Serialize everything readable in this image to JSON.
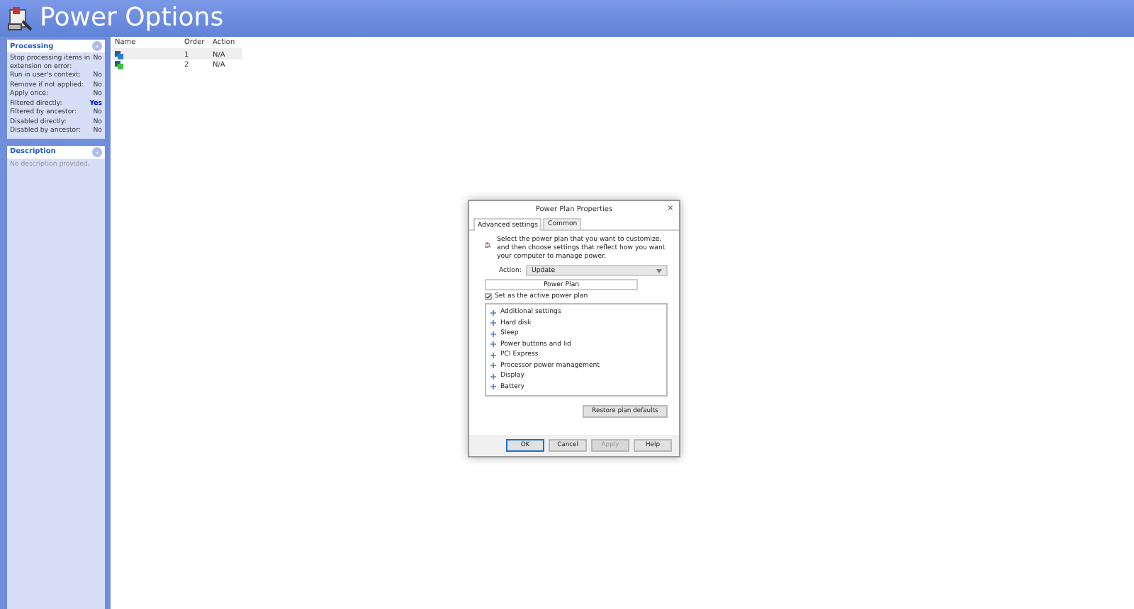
{
  "window": {
    "title": "Power Options"
  },
  "processing": {
    "title": "Processing",
    "collapse": "«",
    "rows": [
      {
        "label": "Stop processing items in extension on error:",
        "value": "No",
        "highlight": false
      },
      {
        "label": "Run in user's context:",
        "value": "No",
        "highlight": false
      },
      {
        "label": "Remove if not applied:",
        "value": "No",
        "highlight": false
      },
      {
        "label": "Apply once:",
        "value": "No",
        "highlight": false
      },
      {
        "label": "Filtered directly:",
        "value": "Yes",
        "highlight": true
      },
      {
        "label": "Filtered by ancestor:",
        "value": "No",
        "highlight": false
      },
      {
        "label": "Disabled directly:",
        "value": "No",
        "highlight": false
      },
      {
        "label": "Disabled by ancestor:",
        "value": "No",
        "highlight": false
      }
    ]
  },
  "description": {
    "title": "Description",
    "collapse": "«",
    "text": "No description provided."
  },
  "table": {
    "columns": [
      "Name",
      "Order",
      "Action"
    ],
    "rows": [
      {
        "order": "1",
        "action": "N/A",
        "selected": true
      },
      {
        "order": "2",
        "action": "N/A",
        "selected": false
      }
    ]
  },
  "dialog": {
    "title": "Power Plan Properties",
    "close": "×",
    "tabs": [
      {
        "label": "Advanced settings",
        "selected": true
      },
      {
        "label": "Common",
        "selected": false
      }
    ],
    "intro": "Select the power plan that you want to customize, and then choose settings that reflect how you want your computer to manage power.",
    "action_label": "Action:",
    "action_value": "Update",
    "plan": "Power Plan",
    "active_checkbox": {
      "label": "Set as the active power plan",
      "checked": true
    },
    "settings": [
      {
        "label": "Additional settings",
        "expanded": false
      },
      {
        "label": "Hard disk",
        "expanded": false
      },
      {
        "label": "Sleep",
        "expanded": false
      },
      {
        "label": "Power buttons and lid",
        "expanded": false
      },
      {
        "label": "PCI Express",
        "expanded": false
      },
      {
        "label": "Processor power management",
        "expanded": false
      },
      {
        "label": "Display",
        "expanded": false
      },
      {
        "label": "Battery",
        "expanded": false
      }
    ],
    "restore": "Restore plan defaults",
    "buttons": [
      {
        "label": "OK",
        "disabled": false,
        "default": true
      },
      {
        "label": "Cancel",
        "disabled": false,
        "default": false
      },
      {
        "label": "Apply",
        "disabled": true,
        "default": false
      },
      {
        "label": "Help",
        "disabled": false,
        "default": false
      }
    ]
  }
}
